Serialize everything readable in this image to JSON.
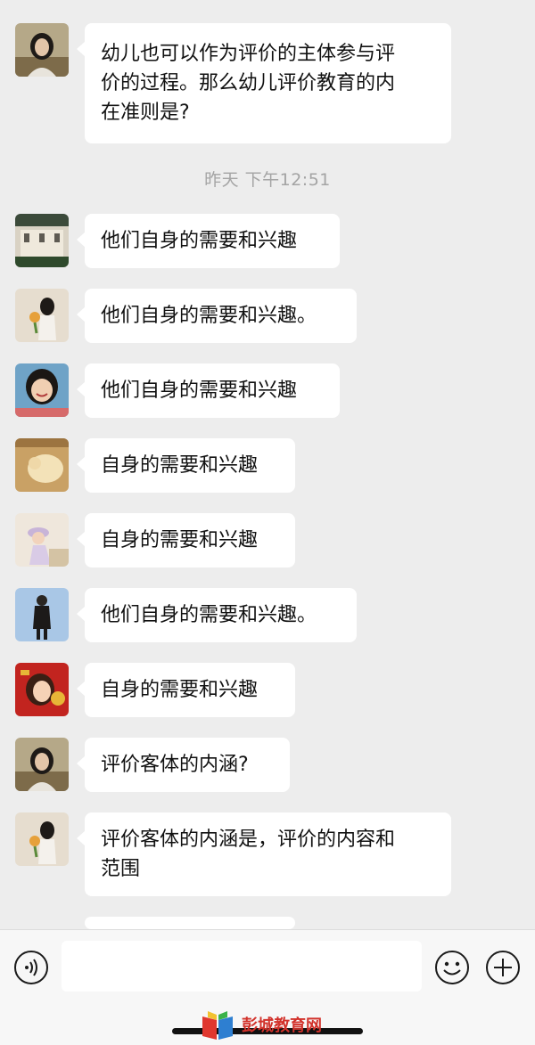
{
  "timestamp": "昨天 下午12:51",
  "messages": [
    {
      "avatar": "avatar-woman-dark-hair",
      "lines": [
        "幼儿也可以作为评价的主体参与评",
        "价的过程。那么幼儿评价教育的内",
        "在准则是?"
      ]
    },
    {
      "avatar": "avatar-building",
      "lines": [
        "他们自身的需要和兴趣"
      ]
    },
    {
      "avatar": "avatar-girl-with-flowers",
      "lines": [
        "他们自身的需要和兴趣。"
      ]
    },
    {
      "avatar": "avatar-smiling-girl",
      "lines": [
        "他们自身的需要和兴趣"
      ]
    },
    {
      "avatar": "avatar-dog",
      "lines": [
        "自身的需要和兴趣"
      ]
    },
    {
      "avatar": "avatar-girl-with-hat",
      "lines": [
        "自身的需要和兴趣"
      ]
    },
    {
      "avatar": "avatar-person-in-coat",
      "lines": [
        "他们自身的需要和兴趣。"
      ]
    },
    {
      "avatar": "avatar-cartoon-girl",
      "lines": [
        "自身的需要和兴趣"
      ]
    },
    {
      "avatar": "avatar-woman-dark-hair",
      "lines": [
        "评价客体的内涵?"
      ]
    },
    {
      "avatar": "avatar-girl-with-flowers",
      "lines": [
        "评价客体的内涵是，评价的内容和",
        "范围"
      ]
    }
  ],
  "input_bar": {
    "voice_icon": "voice-icon",
    "emoji_icon": "emoji-icon",
    "plus_icon": "plus-icon",
    "placeholder": ""
  },
  "watermark": {
    "text": "彭城教育网",
    "icon": "book-logo-icon"
  }
}
